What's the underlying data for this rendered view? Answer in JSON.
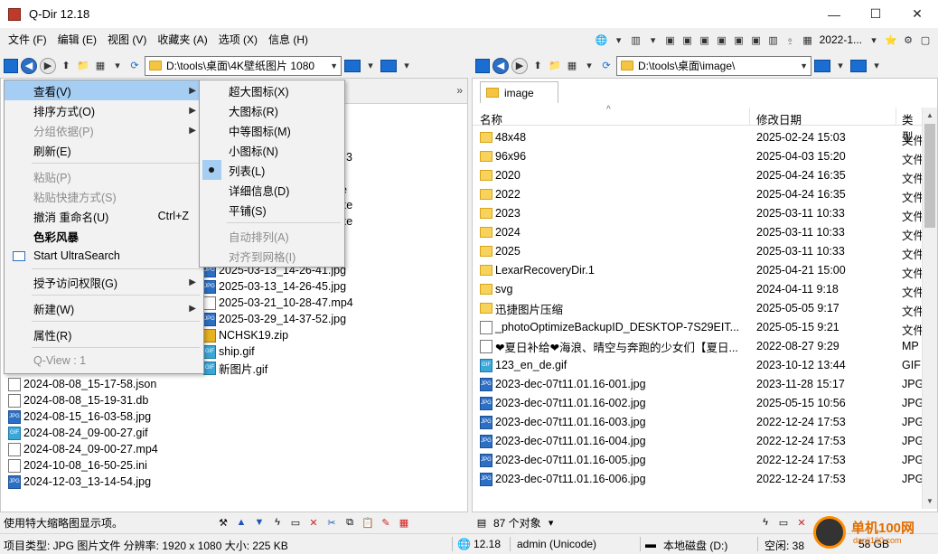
{
  "window": {
    "title": "Q-Dir 12.18",
    "minimize": "—",
    "maximize": "☐",
    "close": "✕"
  },
  "menubar": {
    "items": [
      "文件 (F)",
      "编辑 (E)",
      "视图 (V)",
      "收藏夹 (A)",
      "选项 (X)",
      "信息 (H)"
    ],
    "date_label": "2022-1..."
  },
  "left": {
    "path": "D:\\tools\\桌面\\4K壁纸图片 1080",
    "chevron": "»",
    "files_visible": [
      {
        "name": "2025-03-13_14-26-41.jpg",
        "type": "jpg"
      },
      {
        "name": "2025-03-13_14-26-45.jpg",
        "type": "jpg"
      },
      {
        "name": "2025-03-21_10-28-47.mp4",
        "type": "doc"
      },
      {
        "name": "2025-03-29_14-37-52.jpg",
        "type": "jpg"
      },
      {
        "name": "NCHSK19.zip",
        "type": "zip"
      },
      {
        "name": "ship.gif",
        "type": "gif"
      },
      {
        "name": "新图片.gif",
        "type": "gif"
      }
    ],
    "partial_names": [
      "3",
      "e",
      "xe",
      "xe"
    ],
    "files_col1": [
      {
        "name": "2024-08-08_15-17-58.json",
        "type": "doc"
      },
      {
        "name": "2024-08-08_15-19-31.db",
        "type": "doc"
      },
      {
        "name": "2024-08-15_16-03-58.jpg",
        "type": "jpg"
      },
      {
        "name": "2024-08-24_09-00-27.gif",
        "type": "gif"
      },
      {
        "name": "2024-08-24_09-00-27.mp4",
        "type": "doc"
      },
      {
        "name": "2024-10-08_16-50-25.ini",
        "type": "doc"
      },
      {
        "name": "2024-12-03_13-14-54.jpg",
        "type": "jpg"
      }
    ],
    "status": "使用特大缩略图显示项。"
  },
  "context_menu": {
    "items": [
      {
        "label": "查看(V)",
        "submenu": true,
        "state": "highlight"
      },
      {
        "label": "排序方式(O)",
        "submenu": true
      },
      {
        "label": "分组依据(P)",
        "submenu": true,
        "state": "disabled"
      },
      {
        "label": "刷新(E)"
      },
      {
        "label": "粘贴(P)",
        "state": "disabled"
      },
      {
        "label": "粘贴快捷方式(S)",
        "state": "disabled"
      },
      {
        "label": "撤消 重命名(U)",
        "shortcut": "Ctrl+Z"
      },
      {
        "label": "色彩风暴",
        "state": "bold"
      },
      {
        "label": "Start UltraSearch"
      },
      {
        "label": "授予访问权限(G)",
        "submenu": true
      },
      {
        "label": "新建(W)",
        "submenu": true
      },
      {
        "label": "属性(R)"
      },
      {
        "label": "Q-View : 1",
        "state": "disabled"
      }
    ],
    "submenu": [
      {
        "label": "超大图标(X)"
      },
      {
        "label": "大图标(R)"
      },
      {
        "label": "中等图标(M)"
      },
      {
        "label": "小图标(N)"
      },
      {
        "label": "列表(L)",
        "checked": true
      },
      {
        "label": "详细信息(D)"
      },
      {
        "label": "平铺(S)"
      },
      {
        "label": "自动排列(A)",
        "state": "disabled"
      },
      {
        "label": "对齐到网格(I)",
        "state": "disabled"
      }
    ]
  },
  "right": {
    "path": "D:\\tools\\桌面\\image\\",
    "tab": "image",
    "columns": {
      "name": "名称",
      "date": "修改日期",
      "type": "类型"
    },
    "rows": [
      {
        "name": "48x48",
        "date": "2025-02-24 15:03",
        "type": "文件",
        "icon": "folder"
      },
      {
        "name": "96x96",
        "date": "2025-04-03 15:20",
        "type": "文件",
        "icon": "folder"
      },
      {
        "name": "2020",
        "date": "2025-04-24 16:35",
        "type": "文件",
        "icon": "folder"
      },
      {
        "name": "2022",
        "date": "2025-04-24 16:35",
        "type": "文件",
        "icon": "folder"
      },
      {
        "name": "2023",
        "date": "2025-03-11 10:33",
        "type": "文件",
        "icon": "folder"
      },
      {
        "name": "2024",
        "date": "2025-03-11 10:33",
        "type": "文件",
        "icon": "folder"
      },
      {
        "name": "2025",
        "date": "2025-03-11 10:33",
        "type": "文件",
        "icon": "folder"
      },
      {
        "name": "LexarRecoveryDir.1",
        "date": "2025-04-21 15:00",
        "type": "文件",
        "icon": "folder"
      },
      {
        "name": "svg",
        "date": "2024-04-11 9:18",
        "type": "文件",
        "icon": "folder"
      },
      {
        "name": "迅捷图片压缩",
        "date": "2025-05-05 9:17",
        "type": "文件",
        "icon": "folder"
      },
      {
        "name": "_photoOptimizeBackupID_DESKTOP-7S29EIT...",
        "date": "2025-05-15 9:21",
        "type": "文件",
        "icon": "doc"
      },
      {
        "name": "❤夏日补给❤海浪、晴空与奔跑的少女们【夏日...",
        "date": "2022-08-27 9:29",
        "type": "MP",
        "icon": "doc"
      },
      {
        "name": "123_en_de.gif",
        "date": "2023-10-12 13:44",
        "type": "GIF",
        "icon": "gif"
      },
      {
        "name": "2023-dec-07t11.01.16-001.jpg",
        "date": "2023-11-28 15:17",
        "type": "JPG",
        "icon": "jpg"
      },
      {
        "name": "2023-dec-07t11.01.16-002.jpg",
        "date": "2025-05-15 10:56",
        "type": "JPG",
        "icon": "jpg"
      },
      {
        "name": "2023-dec-07t11.01.16-003.jpg",
        "date": "2022-12-24 17:53",
        "type": "JPG",
        "icon": "jpg"
      },
      {
        "name": "2023-dec-07t11.01.16-004.jpg",
        "date": "2022-12-24 17:53",
        "type": "JPG",
        "icon": "jpg"
      },
      {
        "name": "2023-dec-07t11.01.16-005.jpg",
        "date": "2022-12-24 17:53",
        "type": "JPG",
        "icon": "jpg"
      },
      {
        "name": "2023-dec-07t11.01.16-006.jpg",
        "date": "2022-12-24 17:53",
        "type": "JPG",
        "icon": "jpg"
      }
    ],
    "count": "87 个对象"
  },
  "statusbar": {
    "file_info": "项目类型: JPG 图片文件 分辨率: 1920 x 1080 大小: 225 KB",
    "version": "12.18",
    "user": "admin (Unicode)",
    "disk": "本地磁盘 (D:)",
    "free": "空闲: 38",
    "size": "58 GB"
  },
  "watermark": {
    "text": "单机100网",
    "sub": "danji100.com"
  }
}
